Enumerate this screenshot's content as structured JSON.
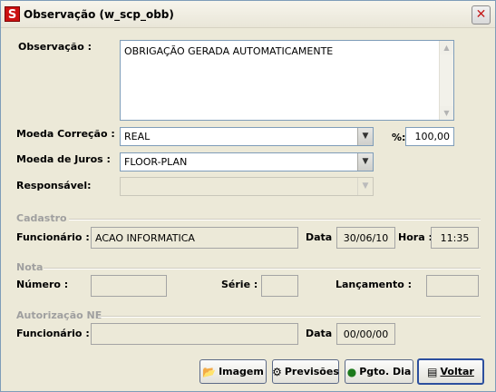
{
  "window": {
    "title": "Observação (w_scp_obb)",
    "app_icon_letter": "S"
  },
  "observacao": {
    "label": "Observação :",
    "value": "OBRIGAÇÃO GERADA AUTOMATICAMENTE"
  },
  "moeda_correcao": {
    "label": "Moeda Correção :",
    "value": "REAL"
  },
  "percent": {
    "label": "%:",
    "value": "100,00"
  },
  "moeda_juros": {
    "label": "Moeda de Juros :",
    "value": "FLOOR-PLAN"
  },
  "responsavel": {
    "label": "Responsável:",
    "value": ""
  },
  "cadastro": {
    "section": "Cadastro",
    "funcionario_label": "Funcionário :",
    "funcionario": "ACAO INFORMATICA",
    "data_label": "Data :",
    "data": "30/06/10",
    "hora_label": "Hora :",
    "hora": "11:35"
  },
  "nota": {
    "section": "Nota",
    "numero_label": "Número :",
    "numero": "",
    "serie_label": "Série :",
    "serie": "",
    "lancamento_label": "Lançamento :",
    "lancamento": ""
  },
  "autorizacao": {
    "section": "Autorização NE",
    "funcionario_label": "Funcionário :",
    "funcionario": "",
    "data_label": "Data :",
    "data": "00/00/00"
  },
  "buttons": {
    "imagem": "Imagem",
    "previsoes": "Previsões",
    "pgto_dia": "Pgto. Dia",
    "voltar": "Voltar"
  }
}
